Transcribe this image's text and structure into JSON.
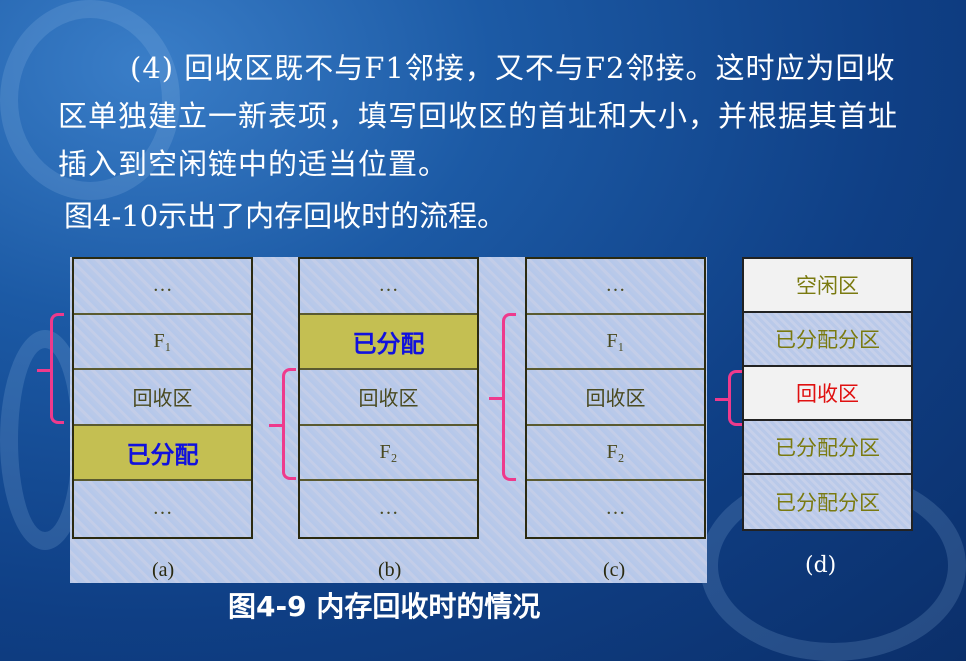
{
  "text": {
    "paragraph": "(4) 回收区既不与F1邻接，又不与F2邻接。这时应为回收区单独建立一新表项，填写回收区的首址和大小，并根据其首址插入到空闲链中的适当位置。",
    "intro": "图4-10示出了内存回收时的流程。"
  },
  "figure": {
    "columns": [
      {
        "label": "(a)",
        "cells": [
          "…",
          "F₁",
          "回收区",
          "已分配",
          "…"
        ]
      },
      {
        "label": "(b)",
        "cells": [
          "…",
          "已分配",
          "回收区",
          "F₂",
          "…"
        ]
      },
      {
        "label": "(c)",
        "cells": [
          "…",
          "F₁",
          "回收区",
          "F₂",
          "…"
        ]
      }
    ],
    "column_d": {
      "label": "(d)",
      "cells": [
        "空闲区",
        "已分配分区",
        "回收区",
        "已分配分区",
        "已分配分区"
      ]
    },
    "caption": "图4-9  内存回收时的情况"
  },
  "colors": {
    "brace": "#ee3a8c",
    "allocated": "#c4bf52",
    "allocated_text": "#1111dd",
    "recycle_text": "#e01010"
  }
}
